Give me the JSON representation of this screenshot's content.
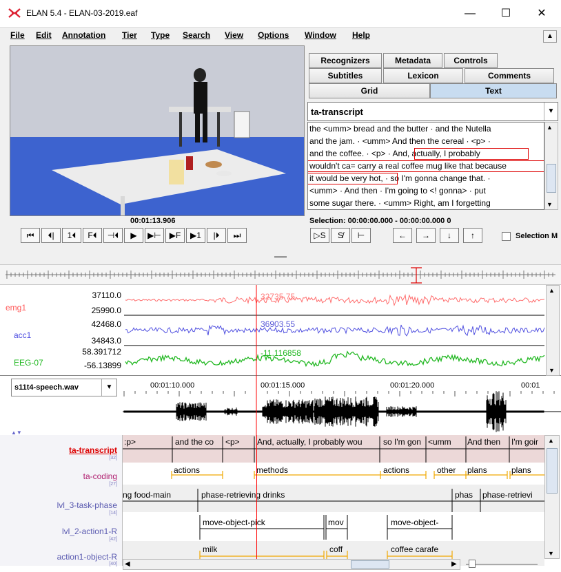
{
  "window": {
    "title": "ELAN 5.4 - ELAN-03-2019.eaf",
    "minimize": "—",
    "maximize": "☐",
    "close": "✕"
  },
  "menu": [
    "File",
    "Edit",
    "Annotation",
    "Tier",
    "Type",
    "Search",
    "View",
    "Options",
    "Window",
    "Help"
  ],
  "tabs_row1": [
    "Recognizers",
    "Metadata",
    "Controls"
  ],
  "tabs_row2": [
    "Subtitles",
    "Lexicon",
    "Comments"
  ],
  "tabs_row3": [
    "Grid",
    "Text"
  ],
  "text_panel": {
    "tier": "ta-transcript",
    "lines": [
      "the <umm> bread and the butter  ·  and the Nutella",
      "and the jam.  ·  <umm> And then the cereal  ·  <p>  ·",
      "and the coffee.  ·  <p>  ·  And, actually, I probably",
      "wouldn't ca= carry a real coffee mug like that because",
      "it would be very hot,  ·  so I'm gonna change that.  ·",
      "<umm>  ·  And then  ·  I'm going to <! gonna>  ·  put",
      "some sugar there.  ·  <umm> Right, am I forgetting"
    ]
  },
  "player": {
    "time": "00:01:13.906",
    "selection": "Selection: 00:00:00.000 - 00:00:00.000  0",
    "buttons": [
      "⏮",
      "⏴|",
      "1⏴",
      "F⏴",
      "⊣⏴",
      "▶",
      "▶⊢",
      "▶F",
      "▶1",
      "|⏵",
      "⏭"
    ],
    "sel_buttons": [
      "▷S",
      "S̸",
      "⊢"
    ],
    "nav_buttons": [
      "←",
      "→",
      "↓",
      "↑"
    ],
    "selection_mode": "Selection M"
  },
  "signals": [
    {
      "name": "emg1",
      "max": "37110.0",
      "min": "25990.0",
      "value": "32735.75",
      "color": "#ff5a5a"
    },
    {
      "name": "acc1",
      "max": "42468.0",
      "min": "34843.0",
      "value": "36903.55",
      "color": "#4a4ae0"
    },
    {
      "name": "EEG-07",
      "max": "58.391712",
      "min": "-56.13899",
      "value": "-11.116858",
      "color": "#22b822"
    }
  ],
  "wave": {
    "file": "s11t4-speech.wav",
    "ticks": [
      "00:01:10.000",
      "00:01:15.000",
      "00:01:20.000",
      "00:01"
    ]
  },
  "tiers": [
    {
      "name": "ta-transcript",
      "count": "[32]",
      "annotations": [
        ":p>",
        "and the co",
        "<p>",
        "And, actually, I probably wou",
        "so I'm gon",
        "<umm",
        "And then",
        "I'm goir"
      ]
    },
    {
      "name": "ta-coding",
      "count": "[27]",
      "annotations": [
        "actions",
        "methods",
        "actions",
        "other",
        "plans",
        "plans"
      ]
    },
    {
      "name": "lvl_3-task-phase",
      "count": "[14]",
      "annotations": [
        "ng food-main",
        "phase-retrieving drinks",
        "phas",
        "phase-retrievi"
      ]
    },
    {
      "name": "lvl_2-action1-R",
      "count": "[42]",
      "annotations": [
        "move-object-pick",
        "mov",
        "move-object-"
      ]
    },
    {
      "name": "action1-object-R",
      "count": "[40]",
      "annotations": [
        "milk",
        "coff",
        "coffee carafe"
      ]
    }
  ],
  "colors": {
    "accent_red": "#ff0000",
    "tab_active": "#c8dcf0",
    "highlight": "#d00000"
  }
}
